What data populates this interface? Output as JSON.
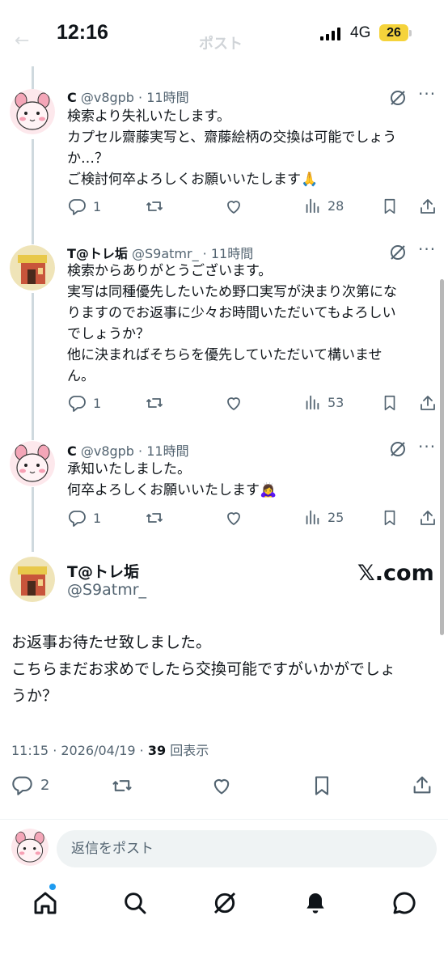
{
  "status_bar": {
    "time": "12:16",
    "network": "4G",
    "battery": "26"
  },
  "header": {
    "title": "ポスト"
  },
  "replies": [
    {
      "name": "C",
      "handle": "@v8gpb",
      "time": "11時間",
      "lines": [
        "検索より失礼いたします。",
        "カプセル齋藤実写と、齋藤絵柄の交換は可能でしょう",
        "か…？",
        "ご検討何卒よろしくお願いいたします🙏"
      ],
      "reply_count": "1",
      "views": "28"
    },
    {
      "name": "T@トレ垢",
      "handle": "@S9atmr_",
      "time": "11時間",
      "lines": [
        "検索からありがとうございます。",
        "実写は同種優先したいため野口実写が決まり次第にな",
        "りますのでお返事に少々お時間いただいてもよろしい",
        "でしょうか？",
        "他に決まればそちらを優先していただいて構いませ",
        "ん。"
      ],
      "reply_count": "1",
      "views": "53"
    },
    {
      "name": "C",
      "handle": "@v8gpb",
      "time": "11時間",
      "lines": [
        "承知いたしました。",
        "何卒よろしくお願いいたします🙇‍♀️"
      ],
      "reply_count": "1",
      "views": "25"
    }
  ],
  "main_post": {
    "name": "T@トレ垢",
    "handle": "@S9atmr_",
    "brand": "𝕏.com",
    "lines": [
      "お返事お待たせ致しました。",
      "こちらまだお求めでしたら交換可能ですがいかがでしょ",
      "うか？"
    ],
    "timestamp": "11:15 · 2026/04/19 · ",
    "views": "39",
    "views_label": " 回表示",
    "reply_count": "2"
  },
  "reply_input": {
    "placeholder": "返信をポスト"
  },
  "colors": {
    "text": "#0f1419",
    "muted": "#536471",
    "accent": "#1d9bf0",
    "thread": "#cfd9de"
  }
}
